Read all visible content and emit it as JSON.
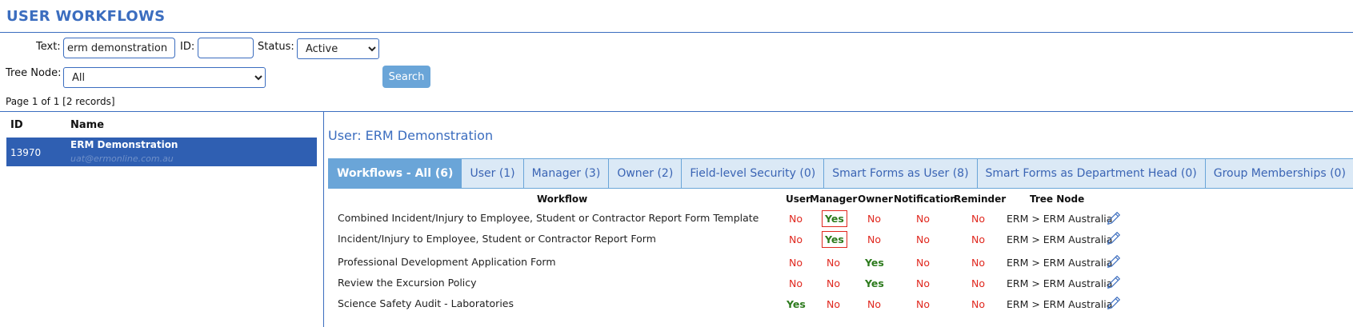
{
  "page_title": "USER WORKFLOWS",
  "filters": {
    "text_label": "Text:",
    "text_value": "erm demonstration",
    "id_label": "ID:",
    "id_value": "",
    "status_label": "Status:",
    "status_value": "Active",
    "tree_node_label": "Tree Node:",
    "tree_node_value": "All",
    "search_label": "Search"
  },
  "page_info": "Page 1 of 1 [2 records]",
  "list": {
    "headers": {
      "id": "ID",
      "name": "Name"
    },
    "selected": {
      "id": "13970",
      "name": "ERM Demonstration",
      "email": "uat@ermonline.com.au"
    }
  },
  "detail": {
    "user_title": "User: ERM Demonstration",
    "tabs": [
      {
        "label": "Workflows - All (6)",
        "active": true
      },
      {
        "label": "User (1)"
      },
      {
        "label": "Manager (3)"
      },
      {
        "label": "Owner (2)"
      },
      {
        "label": "Field-level Security (0)"
      },
      {
        "label": "Smart Forms as User (8)"
      },
      {
        "label": "Smart Forms as Department Head (0)"
      },
      {
        "label": "Group Memberships (0)"
      }
    ],
    "columns": {
      "workflow": "Workflow",
      "user": "User",
      "manager": "Manager",
      "owner": "Owner",
      "notification": "Notification",
      "reminder": "Reminder",
      "tree_node": "Tree Node"
    },
    "rows": [
      {
        "workflow": "Combined Incident/Injury to Employee, Student or Contractor Report Form Template",
        "user": "No",
        "manager": "Yes",
        "owner": "No",
        "notification": "No",
        "reminder": "No",
        "tree_node": "ERM > ERM Australia"
      },
      {
        "workflow": "Incident/Injury to Employee, Student or Contractor Report Form",
        "user": "No",
        "manager": "Yes",
        "owner": "No",
        "notification": "No",
        "reminder": "No",
        "tree_node": "ERM > ERM Australia"
      },
      {
        "workflow": "Professional Development Application Form",
        "user": "No",
        "manager": "No",
        "owner": "Yes",
        "notification": "No",
        "reminder": "No",
        "tree_node": "ERM > ERM Australia"
      },
      {
        "workflow": "Review the Excursion Policy",
        "user": "No",
        "manager": "No",
        "owner": "Yes",
        "notification": "No",
        "reminder": "No",
        "tree_node": "ERM > ERM Australia"
      },
      {
        "workflow": "Science Safety Audit - Laboratories",
        "user": "Yes",
        "manager": "No",
        "owner": "No",
        "notification": "No",
        "reminder": "No",
        "tree_node": "ERM > ERM Australia"
      }
    ]
  },
  "icons": {
    "edit": "pencil-icon"
  },
  "colors": {
    "accent": "#3b6dbf",
    "tab_active": "#6aa5d8",
    "selected_row": "#2f5fb2",
    "no": "#e0281f",
    "yes": "#2d7b1d"
  }
}
